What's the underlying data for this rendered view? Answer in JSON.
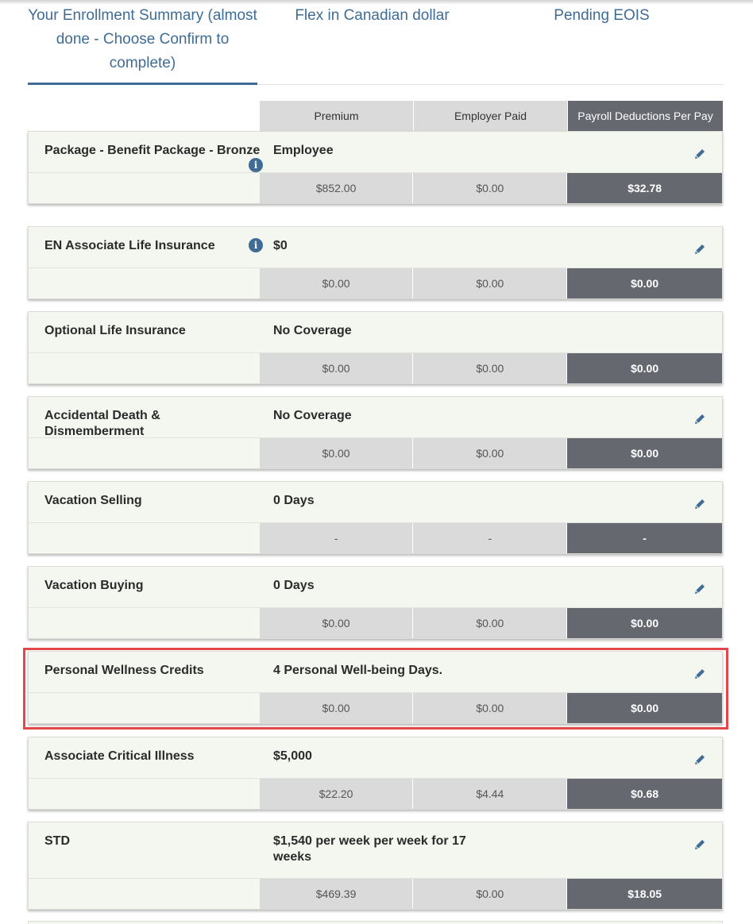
{
  "tabs": [
    {
      "label": "Your Enrollment Summary (almost done - Choose Confirm to complete)"
    },
    {
      "label": "Flex in Canadian dollar"
    },
    {
      "label": "Pending EOIS"
    }
  ],
  "columns": {
    "premium": "Premium",
    "employer_paid": "Employer Paid",
    "payroll": "Payroll Deductions Per Pay"
  },
  "rows": [
    {
      "name": "Package - Benefit Package - Bronze",
      "value": "Employee",
      "premium": "$852.00",
      "employer_paid": "$0.00",
      "payroll": "$32.78"
    },
    {
      "name": "EN Associate Life Insurance",
      "value": "$0",
      "premium": "$0.00",
      "employer_paid": "$0.00",
      "payroll": "$0.00"
    },
    {
      "name": "Optional Life Insurance",
      "value": "No Coverage",
      "premium": "$0.00",
      "employer_paid": "$0.00",
      "payroll": "$0.00"
    },
    {
      "name": "Accidental Death & Dismemberment",
      "value": "No Coverage",
      "premium": "$0.00",
      "employer_paid": "$0.00",
      "payroll": "$0.00"
    },
    {
      "name": "Vacation Selling",
      "value": "0 Days",
      "premium": "-",
      "employer_paid": "-",
      "payroll": "-"
    },
    {
      "name": "Vacation Buying",
      "value": "0 Days",
      "premium": "$0.00",
      "employer_paid": "$0.00",
      "payroll": "$0.00"
    },
    {
      "name": "Personal Wellness Credits",
      "value": "4 Personal Well-being Days.",
      "premium": "$0.00",
      "employer_paid": "$0.00",
      "payroll": "$0.00"
    },
    {
      "name": "Associate Critical Illness",
      "value": "$5,000",
      "premium": "$22.20",
      "employer_paid": "$4.44",
      "payroll": "$0.68"
    },
    {
      "name": "STD",
      "value": "$1,540 per week per week for 17 weeks",
      "premium": "$469.39",
      "employer_paid": "$0.00",
      "payroll": "$18.05"
    }
  ],
  "icons": {
    "info": "info-icon",
    "edit": "pencil-icon"
  },
  "colors": {
    "accent": "#3f6c96",
    "row_bg": "#f3f7ef",
    "cell_light": "#dadada",
    "cell_dark": "#666870",
    "highlight": "#e4474b"
  }
}
